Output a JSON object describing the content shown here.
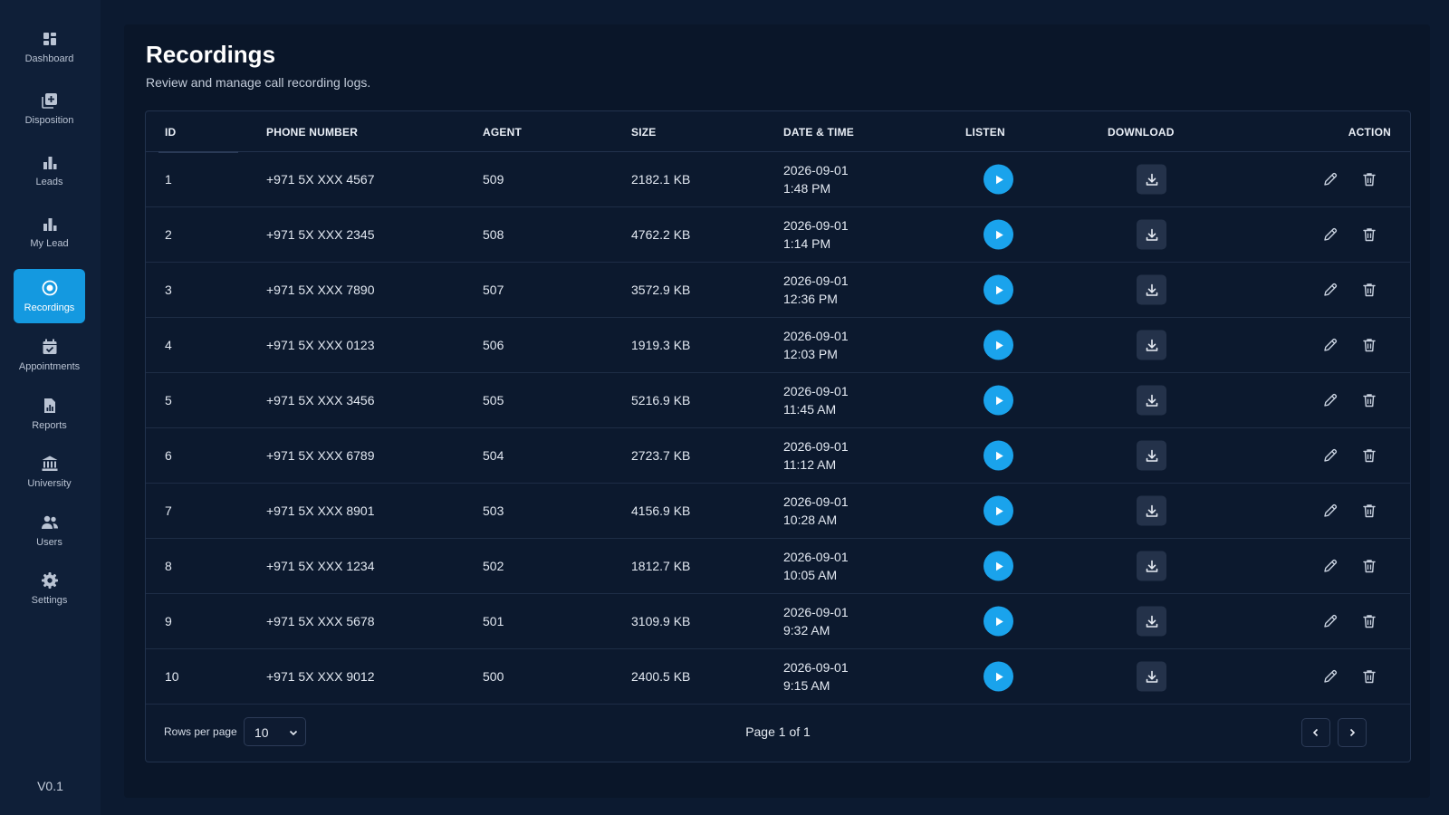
{
  "sidebar": {
    "items": [
      {
        "label": "Dashboard",
        "icon": "dashboard-icon"
      },
      {
        "label": "Disposition",
        "icon": "disposition-icon"
      },
      {
        "label": "Leads",
        "icon": "bar-chart-icon"
      },
      {
        "label": "My Lead",
        "icon": "bar-chart-icon"
      },
      {
        "label": "Recordings",
        "icon": "record-icon",
        "active": true
      },
      {
        "label": "Appointments",
        "icon": "calendar-check-icon"
      },
      {
        "label": "Reports",
        "icon": "report-icon"
      },
      {
        "label": "University",
        "icon": "building-columns-icon"
      },
      {
        "label": "Users",
        "icon": "users-icon"
      },
      {
        "label": "Settings",
        "icon": "gear-icon"
      }
    ],
    "version": "V0.1"
  },
  "page": {
    "title": "Recordings",
    "subtitle": "Review and manage call recording logs."
  },
  "table": {
    "columns": {
      "id": "ID",
      "phone": "PHONE NUMBER",
      "agent": "AGENT",
      "size": "SIZE",
      "datetime": "DATE & TIME",
      "listen": "LISTEN",
      "download": "DOWNLOAD",
      "action": "ACTION"
    },
    "rows": [
      {
        "id": "1",
        "phone": "+971 5X XXX 4567",
        "agent": "509",
        "size": "2182.1 KB",
        "date": "2026-09-01",
        "time": "1:48 PM"
      },
      {
        "id": "2",
        "phone": "+971 5X XXX 2345",
        "agent": "508",
        "size": "4762.2 KB",
        "date": "2026-09-01",
        "time": "1:14 PM"
      },
      {
        "id": "3",
        "phone": "+971 5X XXX 7890",
        "agent": "507",
        "size": "3572.9 KB",
        "date": "2026-09-01",
        "time": "12:36 PM"
      },
      {
        "id": "4",
        "phone": "+971 5X XXX 0123",
        "agent": "506",
        "size": "1919.3 KB",
        "date": "2026-09-01",
        "time": "12:03 PM"
      },
      {
        "id": "5",
        "phone": "+971 5X XXX 3456",
        "agent": "505",
        "size": "5216.9 KB",
        "date": "2026-09-01",
        "time": "11:45 AM"
      },
      {
        "id": "6",
        "phone": "+971 5X XXX 6789",
        "agent": "504",
        "size": "2723.7 KB",
        "date": "2026-09-01",
        "time": "11:12 AM"
      },
      {
        "id": "7",
        "phone": "+971 5X XXX 8901",
        "agent": "503",
        "size": "4156.9 KB",
        "date": "2026-09-01",
        "time": "10:28 AM"
      },
      {
        "id": "8",
        "phone": "+971 5X XXX 1234",
        "agent": "502",
        "size": "1812.7 KB",
        "date": "2026-09-01",
        "time": "10:05 AM"
      },
      {
        "id": "9",
        "phone": "+971 5X XXX 5678",
        "agent": "501",
        "size": "3109.9 KB",
        "date": "2026-09-01",
        "time": "9:32 AM"
      },
      {
        "id": "10",
        "phone": "+971 5X XXX 9012",
        "agent": "500",
        "size": "2400.5 KB",
        "date": "2026-09-01",
        "time": "9:15 AM"
      }
    ]
  },
  "pagination": {
    "rows_per_page_label": "Rows per page",
    "rows_per_page_value": "10",
    "page_info": "Page 1 of 1"
  },
  "colors": {
    "accent": "#1aa3ec",
    "active_nav": "#1499e0",
    "background": "#0c1a30"
  }
}
